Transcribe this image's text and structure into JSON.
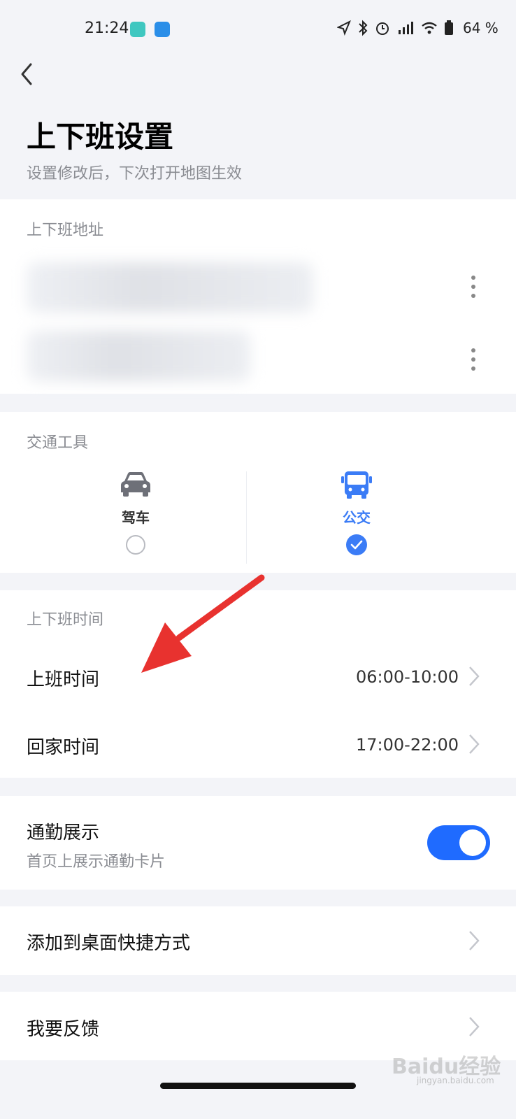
{
  "status_bar": {
    "time": "21:24",
    "battery": "64 %"
  },
  "header": {
    "title": "上下班设置",
    "subtitle": "设置修改后，下次打开地图生效"
  },
  "address_section": {
    "label": "上下班地址"
  },
  "transport_section": {
    "label": "交通工具",
    "options": [
      {
        "label": "驾车",
        "icon": "car-icon",
        "selected": false
      },
      {
        "label": "公交",
        "icon": "bus-icon",
        "selected": true
      }
    ],
    "accent": "#3b7cf6"
  },
  "time_section": {
    "label": "上下班时间",
    "rows": [
      {
        "label": "上班时间",
        "value": "06:00-10:00"
      },
      {
        "label": "回家时间",
        "value": "17:00-22:00"
      }
    ]
  },
  "commute_display": {
    "label": "通勤展示",
    "desc": "首页上展示通勤卡片",
    "enabled": true
  },
  "shortcut": {
    "label": "添加到桌面快捷方式"
  },
  "feedback": {
    "label": "我要反馈"
  },
  "watermark": {
    "text": "Baidu经验",
    "sub": "jingyan.baidu.com"
  }
}
